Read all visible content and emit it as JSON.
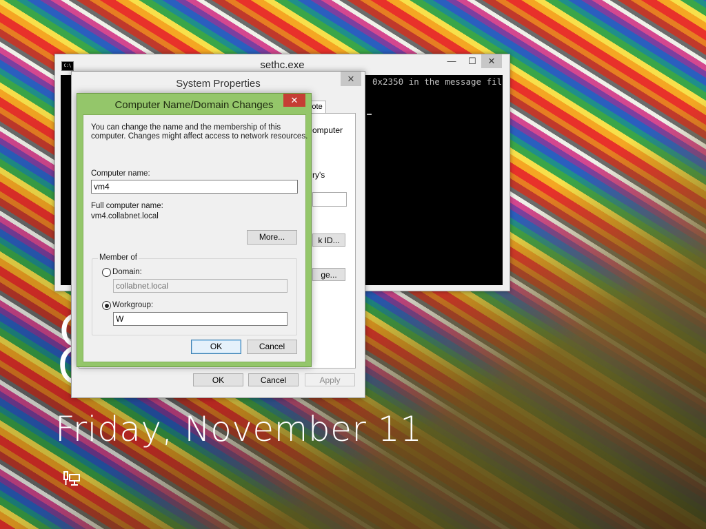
{
  "lock_screen": {
    "date": "Friday, November 11",
    "digit": "8",
    "network_icon": "network-monitor-icon"
  },
  "console": {
    "title": "sethc.exe",
    "icon_label": "C:\\",
    "visible_line": "0x2350 in the message fil",
    "controls": {
      "minimize": "—",
      "maximize": "☐",
      "close": "✕"
    }
  },
  "system_properties": {
    "title": "System Properties",
    "close": "✕",
    "tab_fragment": "note",
    "fragment_computer": "omputer",
    "fragment_rys": "ry's",
    "network_id_button": "k ID...",
    "change_button": "ge...",
    "ok": "OK",
    "cancel": "Cancel",
    "apply": "Apply"
  },
  "computer_name_dialog": {
    "title": "Computer Name/Domain Changes",
    "close": "✕",
    "description_line1": "You can change the name and the membership of this",
    "description_line2": "computer. Changes might affect access to network resources.",
    "computer_name_label": "Computer name:",
    "computer_name_value": "vm4",
    "full_name_label": "Full computer name:",
    "full_name_value": "vm4.collabnet.local",
    "more_button": "More...",
    "member_of_label": "Member of",
    "domain_label": "Domain:",
    "domain_value": "collabnet.local",
    "domain_selected": false,
    "workgroup_label": "Workgroup:",
    "workgroup_value": "W",
    "workgroup_selected": true,
    "ok": "OK",
    "cancel": "Cancel"
  }
}
